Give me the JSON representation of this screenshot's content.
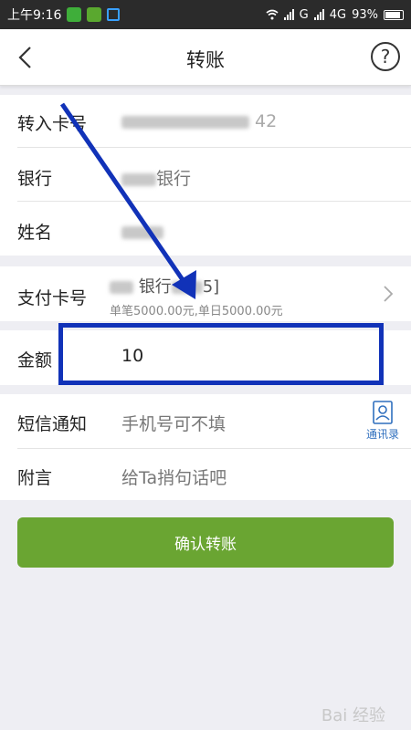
{
  "status_bar": {
    "time": "上午9:16",
    "network1": "G",
    "network2": "4G",
    "battery": "93%"
  },
  "header": {
    "title": "转账",
    "help_label": "?"
  },
  "recipient": {
    "card_label": "转入卡号",
    "card_value_tail": "42",
    "bank_label": "银行",
    "bank_value_tail": "银行",
    "name_label": "姓名"
  },
  "payment": {
    "label": "支付卡号",
    "card_bank": "银行",
    "card_tail": "5]",
    "limit_text": "单笔5000.00元,单日5000.00元"
  },
  "amount": {
    "label": "金额",
    "value": "10"
  },
  "sms": {
    "label": "短信通知",
    "placeholder": "手机号可不填",
    "contacts_label": "通讯录"
  },
  "note": {
    "label": "附言",
    "placeholder": "给Ta捎句话吧"
  },
  "confirm_label": "确认转账",
  "watermark": "Bai 经验",
  "colors": {
    "confirm": "#6aa532",
    "annotation": "#1132b8",
    "link": "#2f6fbe"
  }
}
